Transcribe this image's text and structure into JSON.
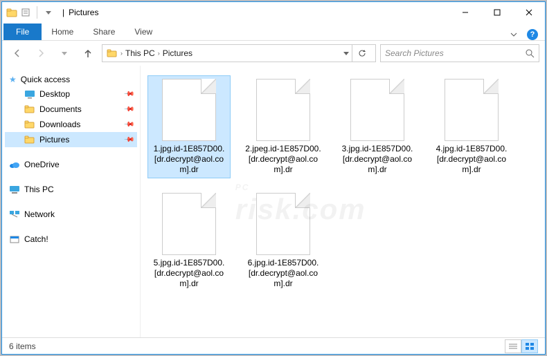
{
  "titlebar": {
    "title": "Pictures"
  },
  "ribbon": {
    "file": "File",
    "tabs": [
      "Home",
      "Share",
      "View"
    ]
  },
  "breadcrumb": {
    "segments": [
      "This PC",
      "Pictures"
    ]
  },
  "search": {
    "placeholder": "Search Pictures"
  },
  "nav": {
    "quick_access": "Quick access",
    "quick_items": [
      "Desktop",
      "Documents",
      "Downloads",
      "Pictures"
    ],
    "onedrive": "OneDrive",
    "thispc": "This PC",
    "network": "Network",
    "catch": "Catch!"
  },
  "files": [
    {
      "name": "1.jpg.id-1E857D00.[dr.decrypt@aol.com].dr",
      "selected": true
    },
    {
      "name": "2.jpeg.id-1E857D00.[dr.decrypt@aol.com].dr",
      "selected": false
    },
    {
      "name": "3.jpg.id-1E857D00.[dr.decrypt@aol.com].dr",
      "selected": false
    },
    {
      "name": "4.jpg.id-1E857D00.[dr.decrypt@aol.com].dr",
      "selected": false
    },
    {
      "name": "5.jpg.id-1E857D00.[dr.decrypt@aol.com].dr",
      "selected": false
    },
    {
      "name": "6.jpg.id-1E857D00.[dr.decrypt@aol.com].dr",
      "selected": false
    }
  ],
  "status": {
    "count": "6 items"
  },
  "watermark": {
    "big": "PC",
    "sub": "risk.com"
  }
}
